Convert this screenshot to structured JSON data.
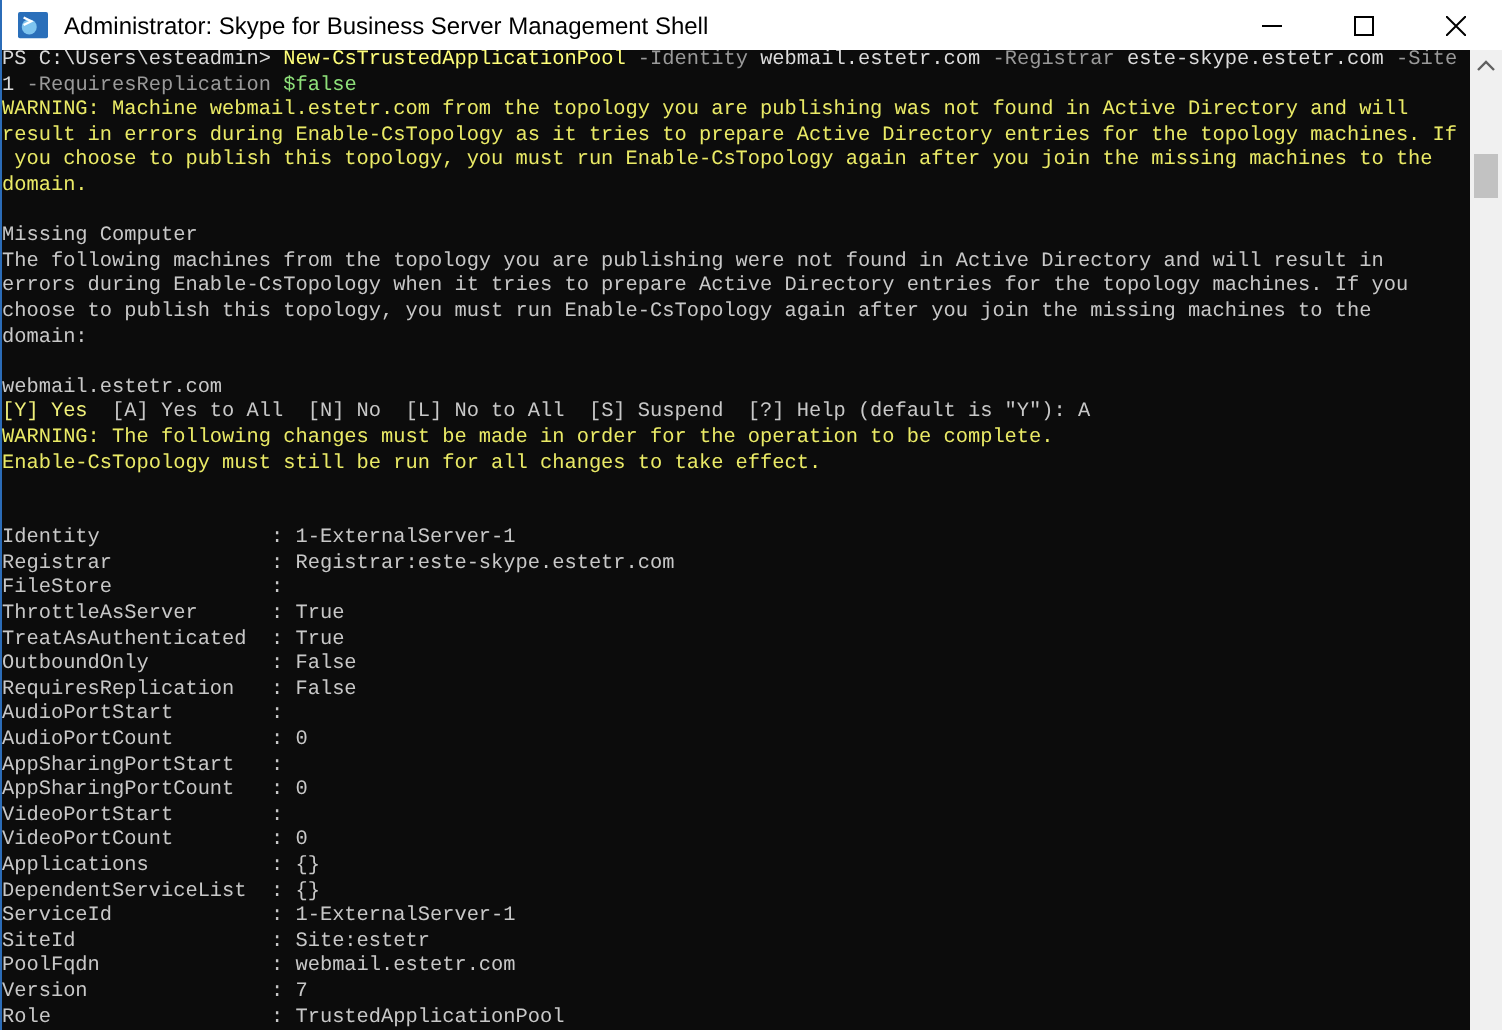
{
  "window": {
    "title": "Administrator: Skype for Business Server Management Shell"
  },
  "console": {
    "lines": [
      {
        "kind": "command",
        "segments": [
          {
            "kind": "prompt",
            "text": "PS C:\\Users\\esteadmin> "
          },
          {
            "kind": "cmdlet",
            "text": "New-CsTrustedApplicationPool"
          },
          {
            "kind": "parameter",
            "text": " -Identity"
          },
          {
            "kind": "argument",
            "text": " webmail.estetr.com"
          },
          {
            "kind": "parameter",
            "text": " -Registrar"
          },
          {
            "kind": "argument",
            "text": " este-skype.estetr.com"
          },
          {
            "kind": "parameter",
            "text": " -Site"
          }
        ]
      },
      {
        "kind": "command",
        "segments": [
          {
            "kind": "argument",
            "text": "1"
          },
          {
            "kind": "parameter",
            "text": " -RequiresReplication"
          },
          {
            "kind": "variable",
            "text": " $false"
          }
        ]
      },
      {
        "kind": "warning",
        "text": "WARNING: Machine webmail.estetr.com from the topology you are publishing was not found in Active Directory and will"
      },
      {
        "kind": "warning",
        "text": "result in errors during Enable-CsTopology as it tries to prepare Active Directory entries for the topology machines. If"
      },
      {
        "kind": "warning",
        "text": " you choose to publish this topology, you must run Enable-CsTopology again after you join the missing machines to the"
      },
      {
        "kind": "warning",
        "text": "domain."
      },
      {
        "kind": "blank"
      },
      {
        "kind": "output",
        "text": "Missing Computer"
      },
      {
        "kind": "output",
        "text": "The following machines from the topology you are publishing were not found in Active Directory and will result in"
      },
      {
        "kind": "output",
        "text": "errors during Enable-CsTopology when it tries to prepare Active Directory entries for the topology machines. If you"
      },
      {
        "kind": "output",
        "text": "choose to publish this topology, you must run Enable-CsTopology again after you join the missing machines to the"
      },
      {
        "kind": "output",
        "text": "domain:"
      },
      {
        "kind": "blank"
      },
      {
        "kind": "output",
        "text": "webmail.estetr.com"
      },
      {
        "kind": "command",
        "segments": [
          {
            "kind": "choice",
            "text": "[Y] Yes"
          },
          {
            "kind": "output",
            "text": "  [A] Yes to All  [N] No  [L] No to All  [S] Suspend  [?] Help (default is \"Y\"): A"
          }
        ]
      },
      {
        "kind": "warning",
        "text": "WARNING: The following changes must be made in order for the operation to be complete."
      },
      {
        "kind": "warning",
        "text": "Enable-CsTopology must still be run for all changes to take effect."
      },
      {
        "kind": "blank"
      },
      {
        "kind": "blank"
      },
      {
        "kind": "output",
        "text": "Identity              : 1-ExternalServer-1"
      },
      {
        "kind": "output",
        "text": "Registrar             : Registrar:este-skype.estetr.com"
      },
      {
        "kind": "output",
        "text": "FileStore             :"
      },
      {
        "kind": "output",
        "text": "ThrottleAsServer      : True"
      },
      {
        "kind": "output",
        "text": "TreatAsAuthenticated  : True"
      },
      {
        "kind": "output",
        "text": "OutboundOnly          : False"
      },
      {
        "kind": "output",
        "text": "RequiresReplication   : False"
      },
      {
        "kind": "output",
        "text": "AudioPortStart        :"
      },
      {
        "kind": "output",
        "text": "AudioPortCount        : 0"
      },
      {
        "kind": "output",
        "text": "AppSharingPortStart   :"
      },
      {
        "kind": "output",
        "text": "AppSharingPortCount   : 0"
      },
      {
        "kind": "output",
        "text": "VideoPortStart        :"
      },
      {
        "kind": "output",
        "text": "VideoPortCount        : 0"
      },
      {
        "kind": "output",
        "text": "Applications          : {}"
      },
      {
        "kind": "output",
        "text": "DependentServiceList  : {}"
      },
      {
        "kind": "output",
        "text": "ServiceId             : 1-ExternalServer-1"
      },
      {
        "kind": "output",
        "text": "SiteId                : Site:estetr"
      },
      {
        "kind": "output",
        "text": "PoolFqdn              : webmail.estetr.com"
      },
      {
        "kind": "output",
        "text": "Version               : 7"
      },
      {
        "kind": "output",
        "text": "Role                  : TrustedApplicationPool"
      }
    ]
  }
}
